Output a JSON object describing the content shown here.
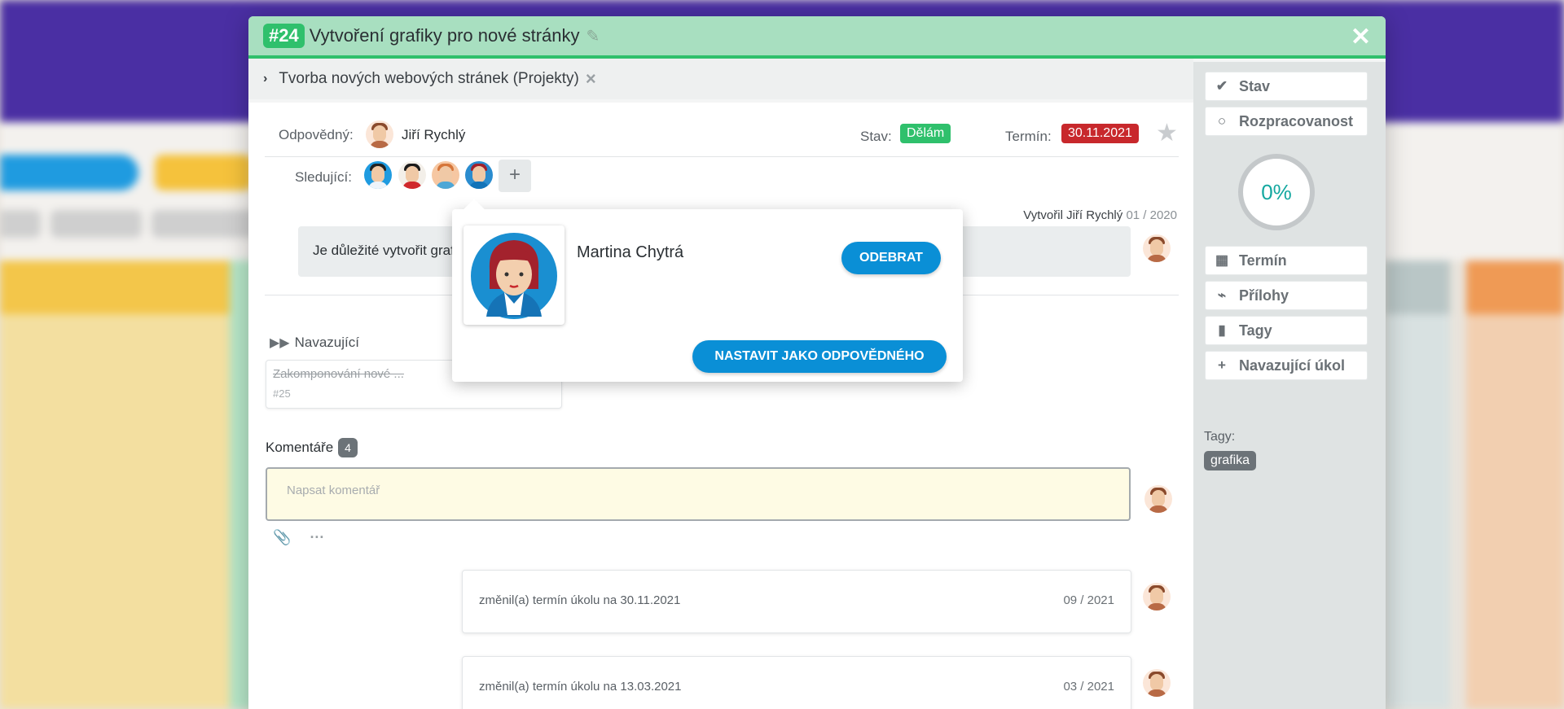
{
  "task": {
    "id": "#24",
    "title": "Vytvoření grafiky pro nové stránky"
  },
  "breadcrumb": {
    "project": "Tvorba nových webových stránek (Projekty)"
  },
  "details": {
    "responsible_label": "Odpovědný:",
    "responsible_name": "Jiří Rychlý",
    "status_label": "Stav:",
    "status_value": "Dělám",
    "deadline_label": "Termín:",
    "deadline_value": "30.11.2021",
    "followers_label": "Sledující:",
    "created_prefix": "Vytvořil",
    "created_by": "Jiří Rychlý",
    "created_date": "01 / 2020",
    "description": "Je důležité vytvořit grafiku"
  },
  "follow_up": {
    "heading": "Navazující",
    "item_title": "Zakomponování nové ...",
    "item_id": "#25"
  },
  "comments": {
    "heading": "Komentáře",
    "count": "4",
    "placeholder": "Napsat komentář",
    "log": [
      {
        "text": "změnil(a) termín úkolu na 30.11.2021",
        "date": "09 / 2021"
      },
      {
        "text": "změnil(a) termín úkolu na 13.03.2021",
        "date": "03 / 2021"
      }
    ]
  },
  "sidebar": {
    "stav": "Stav",
    "progress": "Rozpracovanost",
    "progress_value": "0%",
    "termin": "Termín",
    "prilohy": "Přílohy",
    "tagy": "Tagy",
    "navazujici": "Navazující úkol",
    "tags_label": "Tagy:",
    "tag": "grafika"
  },
  "popover": {
    "name": "Martina Chytrá",
    "remove_button": "ODEBRAT",
    "set_responsible_button": "NASTAVIT JAKO ODPOVĚDNÉHO"
  },
  "colors": {
    "header_bg": "#a8dfc0",
    "accent_green": "#2fc06c",
    "deadline_red": "#c8282c",
    "button_blue": "#0a8fd6"
  }
}
